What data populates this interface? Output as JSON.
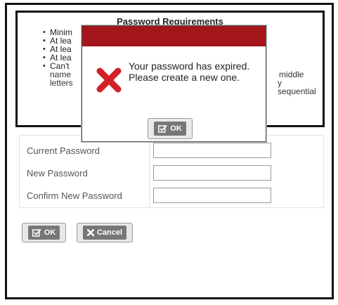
{
  "requirements": {
    "title": "Password Requirements",
    "items_left": [
      "Minim",
      "At lea",
      "At lea",
      "At lea",
      "Can't"
    ],
    "line_name": "name",
    "line_letters": "letters",
    "fragment_middle": "middle",
    "fragment_sequential": "y sequential"
  },
  "form": {
    "current_label": "Current Password",
    "new_label": "New Password",
    "confirm_label": "Confirm New Password",
    "current_value": "",
    "new_value": "",
    "confirm_value": ""
  },
  "buttons": {
    "ok_label": "OK",
    "cancel_label": "Cancel"
  },
  "modal": {
    "message": "Your password has expired. Please create a new one.",
    "ok_label": "OK",
    "header_color": "#a3161c",
    "icon": "error-x-icon",
    "icon_color": "#d42027"
  }
}
